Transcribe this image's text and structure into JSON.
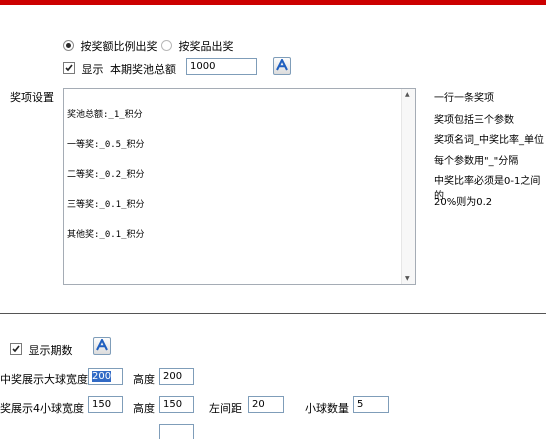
{
  "mode": {
    "ratio_label": "按奖额比例出奖",
    "prize_label": "按奖品出奖",
    "selected": "ratio"
  },
  "display": {
    "label": "显示",
    "pool_label": "本期奖池总额",
    "pool_value": "1000",
    "checked": true
  },
  "prize_settings": {
    "label": "奖项设置",
    "lines": [
      "奖池总额:_1_积分",
      "一等奖:_0.5_积分",
      "二等奖:_0.2_积分",
      "三等奖:_0.1_积分",
      "其他奖:_0.1_积分"
    ]
  },
  "help_lines": [
    "一行一条奖项",
    "奖项包括三个参数",
    "奖项名词_中奖比率_单位",
    "每个参数用\"_\"分隔",
    "中奖比率必须是0-1之间的",
    "20%则为0.2"
  ],
  "bottom": {
    "show_period_label": "显示期数",
    "show_period_checked": true,
    "big_ball_label": "中奖展示大球宽度",
    "big_ball_width": "200",
    "big_ball_height_label": "高度",
    "big_ball_height": "200",
    "small_ball_label": "奖展示4小球宽度",
    "small_ball_width": "150",
    "small_ball_height_label": "高度",
    "small_ball_height": "150",
    "left_spacing_label": "左间距",
    "left_spacing": "20",
    "small_ball_count_label": "小球数量",
    "small_ball_count": "5"
  },
  "colors": {
    "top_bar": "#cc0000",
    "input_border": "#7f9db9",
    "selection": "#316ac5",
    "font_button_glyph": "#1f5fbf"
  },
  "icons": {
    "font_button": "font-A-icon",
    "checkbox": "checkmark-icon"
  }
}
